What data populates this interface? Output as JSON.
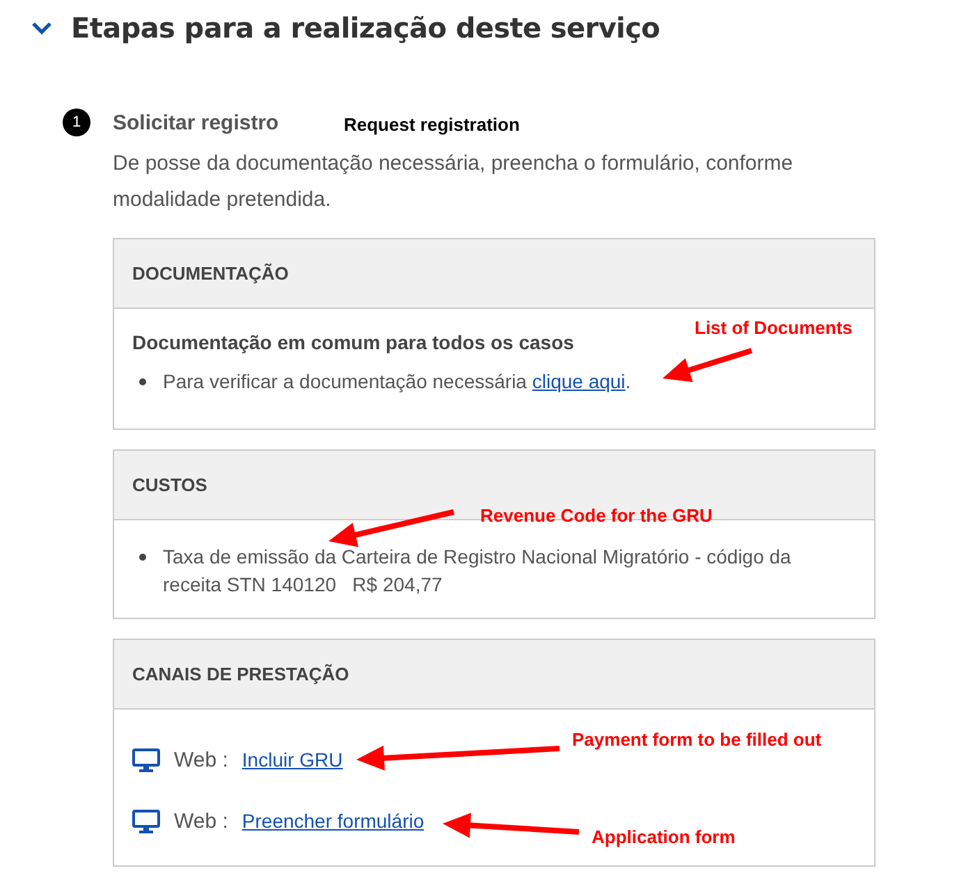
{
  "section": {
    "title": "Etapas para a realização deste serviço",
    "expanded": true
  },
  "step": {
    "number": "1",
    "title": "Solicitar registro",
    "description": "De posse da documentação necessária, preencha o formulário, conforme modalidade pretendida."
  },
  "cards": [
    {
      "kind": "documents",
      "title": "DOCUMENTAÇÃO",
      "subtitle": "Documentação em comum para todos os casos",
      "items": [
        {
          "text": "Para verificar a documentação necessária",
          "link": "clique aqui",
          "after": "."
        }
      ]
    },
    {
      "kind": "costs",
      "title": "CUSTOS",
      "items": [
        {
          "text": "Taxa de emissão da Carteira de Registro Nacional Migratório - código da receita STN 140120",
          "price": "R$ 204,77"
        }
      ]
    },
    {
      "kind": "channels",
      "title": "CANAIS DE PRESTAÇÃO",
      "items": [
        {
          "label": "Web :",
          "link": "Incluir GRU"
        },
        {
          "label": "Web :",
          "link": "Preencher formulário"
        }
      ]
    }
  ],
  "annotations": [
    {
      "text": "Request registration",
      "arrow": false
    },
    {
      "text": "List of Documents",
      "arrow": true
    },
    {
      "text": "Revenue Code for the GRU",
      "arrow": true
    },
    {
      "text": "Payment form to be filled out",
      "arrow": true
    },
    {
      "text": "Application form",
      "arrow": true
    }
  ]
}
